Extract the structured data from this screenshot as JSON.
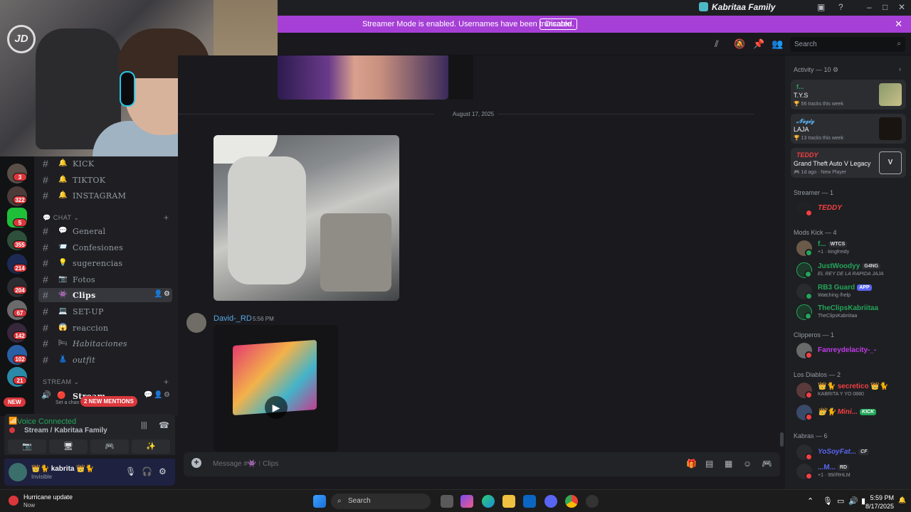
{
  "window": {
    "title": "Kabritaa Family"
  },
  "banner": {
    "text": "Streamer Mode is enabled. Usernames have been truncated.",
    "disable_label": "Disable"
  },
  "header": {
    "search_placeholder": "Search"
  },
  "servers": {
    "badges": [
      "3",
      "322",
      "5",
      "355",
      "214",
      "204",
      "67",
      "142",
      "102",
      "21"
    ],
    "new_label": "NEW"
  },
  "channels": {
    "top": [
      {
        "emoji": "🔔",
        "name": "KICK"
      },
      {
        "emoji": "🔔",
        "name": "TIKTOK"
      },
      {
        "emoji": "🔔",
        "name": "INSTAGRAM"
      }
    ],
    "chat_category": "CHAT",
    "chat": [
      {
        "emoji": "💬",
        "name": "General"
      },
      {
        "emoji": "📨",
        "name": "Confesiones"
      },
      {
        "emoji": "💡",
        "name": "sugerencias"
      },
      {
        "emoji": "📷",
        "name": "Fotos"
      },
      {
        "emoji": "👾",
        "name": "Clips"
      },
      {
        "emoji": "💻",
        "name": "SET-UP"
      },
      {
        "emoji": "😱",
        "name": "reaccion"
      },
      {
        "emoji": "🛏",
        "name": "Habitaciones"
      },
      {
        "emoji": "👗",
        "name": "outfit"
      }
    ],
    "stream_category": "STREAM",
    "stream_channel": "Stream",
    "stream_sub": "Set a chan",
    "mentions_label": "2 NEW MENTIONS"
  },
  "voice": {
    "status": "Voice Connected",
    "location": "Stream / Kabritaa Family"
  },
  "user": {
    "name": "kabrita",
    "status": "Invisible"
  },
  "chat": {
    "date_divider": "August 17, 2025",
    "author": "David-_RD",
    "time": "5:56 PM",
    "composer_placeholder": "Message #👾 ⁝ Clips"
  },
  "members": {
    "activity_header": "Activity — 10",
    "activities": [
      {
        "user": "f...",
        "title": "T.Y.S",
        "meta": "56 tracks this week"
      },
      {
        "user": "𝓝𝓮𝔃𝓲𝔃",
        "title": "LAJA",
        "meta": "13 tracks this week"
      },
      {
        "user": "TEDDY",
        "title": "Grand Theft Auto V Legacy",
        "meta": "1d ago · New Player"
      }
    ],
    "streamer_header": "Streamer — 1",
    "streamer": "TEDDY",
    "mods_header": "Mods Kick — 4",
    "mods": [
      {
        "name": "f...",
        "tag": "WTCS",
        "sub": "+1 · kingfreidy",
        "color": "#23a55a"
      },
      {
        "name": "JustWoodyy",
        "tag": "G4NG",
        "sub": "EL REY DE LA RAPIDA JAJA",
        "color": "#23a55a"
      },
      {
        "name": "RB3 Guard",
        "tag": "APP",
        "sub": "Watching /help",
        "color": "#23a55a"
      },
      {
        "name": "TheClipsKabriitaa",
        "tag": "",
        "sub": "TheClipsKabriitaa",
        "color": "#23a55a"
      }
    ],
    "clipers_header": "Clipperos — 1",
    "clipers": [
      {
        "name": "Fanreydelacity-_-",
        "color": "#c03ce8"
      }
    ],
    "diablos_header": "Los Diablos — 2",
    "diablos": [
      {
        "name": "secretico",
        "sub": "KABRITA Y YO 0880",
        "color": "#f23f43"
      },
      {
        "name": "Mini...",
        "tag": "KICK",
        "color": "#f23f43"
      }
    ],
    "kabras_header": "Kabras — 6",
    "kabras": [
      {
        "name": "YoSoyFat...",
        "tag": "CF",
        "color": "#5865f2"
      },
      {
        "name": "...M...",
        "tag": "RD",
        "sub": "+1 · 99//RHLM",
        "color": "#5865f2"
      }
    ]
  },
  "taskbar": {
    "notification_title": "Hurricane update",
    "notification_sub": "Now",
    "search_label": "Search",
    "time": "5:59 PM",
    "date": "8/17/2025"
  },
  "colors": {
    "accent": "#a63fd6",
    "online": "#23a55a",
    "dnd": "#f23f43",
    "brand": "#5865f2"
  }
}
